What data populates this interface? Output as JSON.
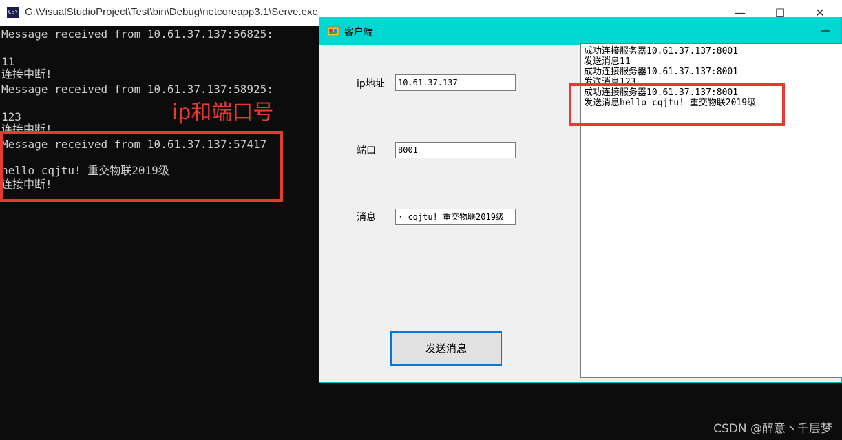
{
  "console": {
    "title": "G:\\VisualStudioProject\\Test\\bin\\Debug\\netcoreapp3.1\\Serve.exe",
    "icon_text": "C:\\",
    "controls": {
      "minimize": "—",
      "maximize": "☐",
      "close": "✕"
    },
    "lines": [
      "Message received from 10.61.37.137:56825:",
      "",
      "11",
      "连接中断!",
      "Message received from 10.61.37.137:58925:",
      "",
      "123",
      "连接中断!",
      "Message received from 10.61.37.137:57417",
      "",
      "hello cqjtu! 重交物联2019级",
      "连接中断!"
    ]
  },
  "annotation": {
    "label": "ip和端口号",
    "color": "#e53935"
  },
  "client": {
    "title": "客户端",
    "minimize": "—",
    "ip_label": "ip地址",
    "ip_value": "10.61.37.137",
    "port_label": "端口",
    "port_value": "8001",
    "message_label": "消息",
    "message_value": "· cqjtu! 重交物联2019级",
    "send_button": "发送消息",
    "log_lines": [
      "成功连接服务器10.61.37.137:8001",
      "发送消息11",
      "成功连接服务器10.61.37.137:8001",
      "发送消息123",
      "成功连接服务器10.61.37.137:8001",
      "发送消息hello cqjtu! 重交物联2019级"
    ]
  },
  "watermark": "CSDN @醉意丶千层梦"
}
